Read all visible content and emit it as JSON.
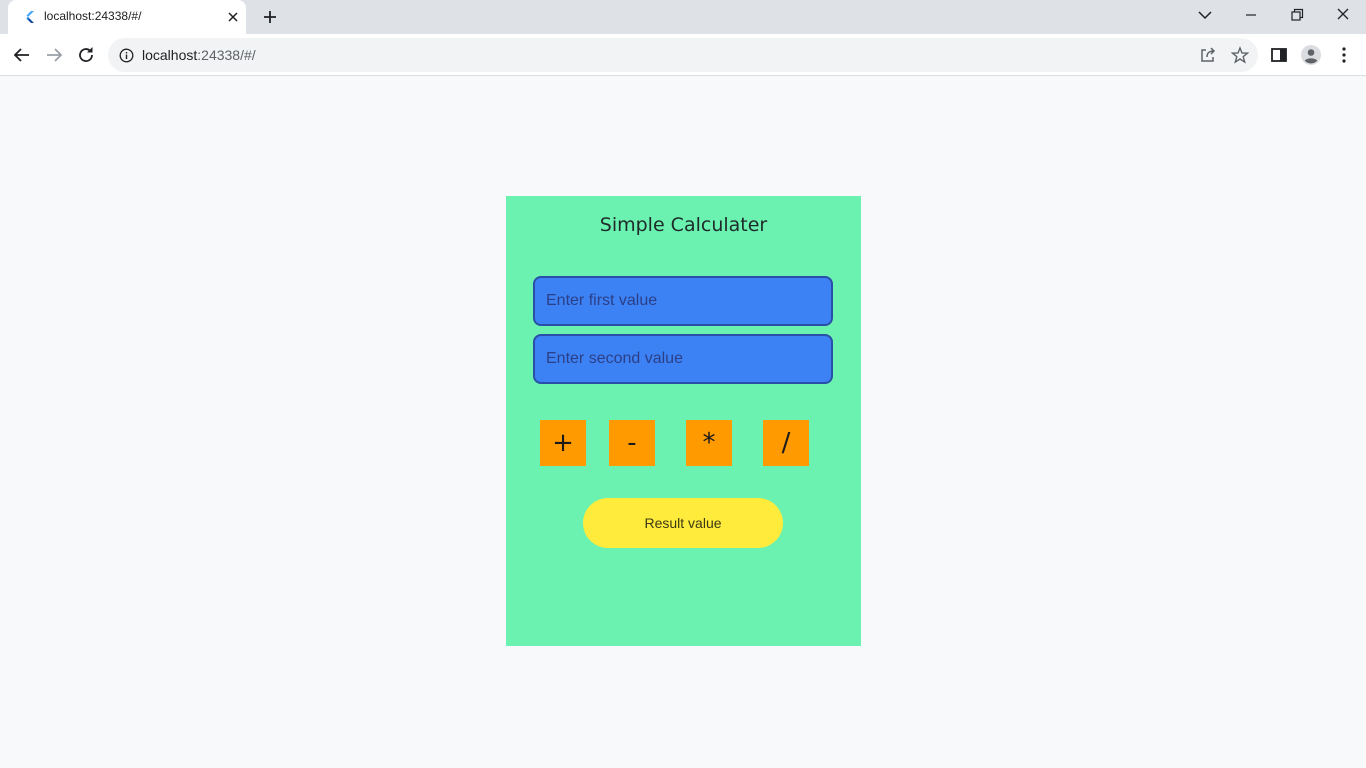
{
  "browser": {
    "tab": {
      "title": "localhost:24338/#/"
    },
    "address_bar": {
      "host": "localhost",
      "path": ":24338/#/"
    }
  },
  "app": {
    "title": "Simple Calculater",
    "first_input": {
      "placeholder": "Enter first value",
      "value": ""
    },
    "second_input": {
      "placeholder": "Enter second value",
      "value": ""
    },
    "operations": {
      "add": "+",
      "subtract": "-",
      "multiply": "*",
      "divide": "/"
    },
    "result_label": "Result value",
    "colors": {
      "card": "#6bf1b0",
      "input": "#3d82f5",
      "operator_button": "#ff9b00",
      "result_button": "#ffeb3b"
    }
  }
}
